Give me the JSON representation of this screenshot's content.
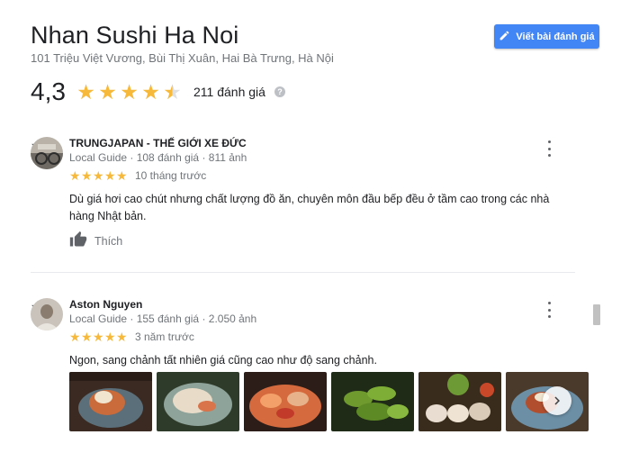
{
  "place": {
    "title": "Nhan Sushi Ha Noi",
    "address": "101 Triệu Việt Vương, Bùi Thị Xuân, Hai Bà Trưng, Hà Nội",
    "write_review_label": "Viết bài đánh giá",
    "rating_value": "4,3",
    "rating_count": "211 đánh giá",
    "rating_stars": 4.3
  },
  "reviews": [
    {
      "name": "TRUNGJAPAN - THẾ GIỚI XE ĐỨC",
      "guide": "Local Guide",
      "stats": " · 108 đánh giá · 811 ảnh",
      "stars": 5,
      "time": "10 tháng trước",
      "text": "Dù giá hơi cao chút nhưng chất lượng đồ ăn, chuyên môn đầu bếp đều ở tầm cao trong các nhà hàng Nhật bản.",
      "like_label": "Thích"
    },
    {
      "name": "Aston Nguyen",
      "guide": "Local Guide",
      "stats": " · 155 đánh giá · 2.050 ảnh",
      "stars": 5,
      "time": "3 năm trước",
      "text": "Ngon, sang chảnh tất nhiên giá cũng cao như độ sang chảnh."
    }
  ],
  "colors": {
    "accent": "#4285f4",
    "star": "#f6b93b",
    "badge": "#f57c00"
  },
  "icons": {
    "write": "pencil-icon",
    "help": "help-icon",
    "more": "more-vert-icon",
    "like": "thumbs-up-icon",
    "next": "chevron-right-icon"
  }
}
